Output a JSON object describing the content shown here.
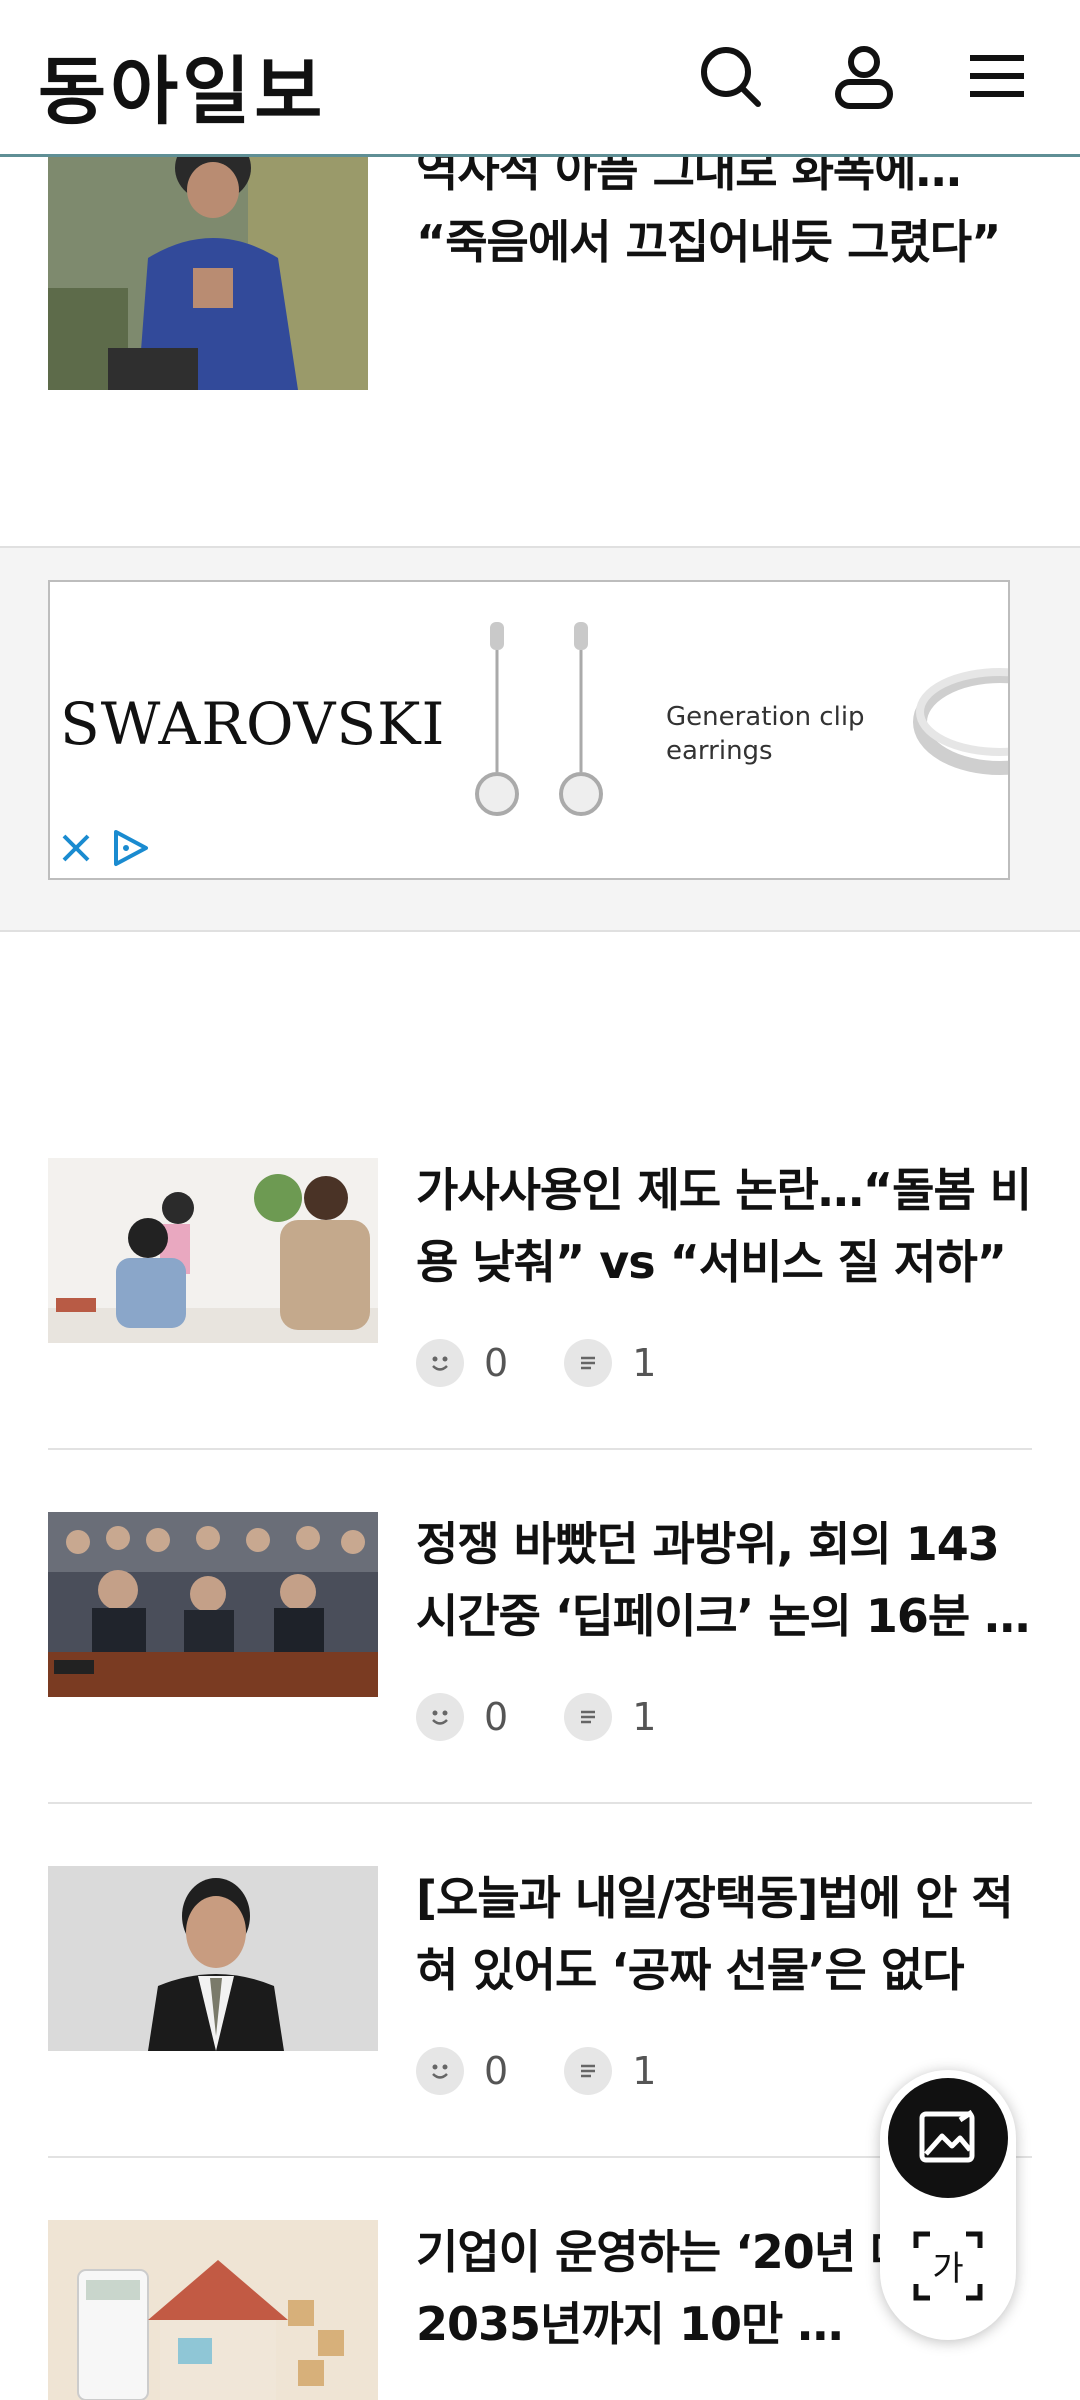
{
  "header": {
    "logo": "동아일보",
    "icons": [
      "search-icon",
      "user-icon",
      "menu-icon"
    ]
  },
  "articles": [
    {
      "title": "역사적 아픔 그대로 화폭에… “죽음에서 끄집어내듯 그렸다”",
      "thumb": "woman in blue seated portrait"
    },
    {
      "title": "가사사용인 제도 논란…“돌봄 비용 낮춰” vs “서비스 질 저하”",
      "likes": "0",
      "comments": "1",
      "thumb": "caregiver with children"
    },
    {
      "title": "정쟁 바빴던 과방위, 회의 143시간중 ‘딥페이크’ 논의 16분 …",
      "likes": "0",
      "comments": "1",
      "thumb": "committee meeting"
    },
    {
      "title": "[오늘과 내일/장택동]법에 안 적혀 있어도 ‘공짜 선물’은 없다",
      "likes": "0",
      "comments": "1",
      "thumb": "columnist portrait"
    },
    {
      "title": "기업이 운영하는 ‘20년 대주택’ 2035년까지 10만 …",
      "thumb": "house model with calculator"
    }
  ],
  "ad": {
    "brand": "SWAROVSKI",
    "text_line1": "Generation clip",
    "text_line2": "earrings",
    "icons": [
      "close-icon",
      "adchoices-icon"
    ]
  },
  "fab": {
    "icons": [
      "image-search-icon",
      "translate-icon"
    ]
  },
  "colors": {
    "header_border": "#5f8f95",
    "ad_band": "#f4f4f4",
    "separator": "#e2e2e2"
  }
}
